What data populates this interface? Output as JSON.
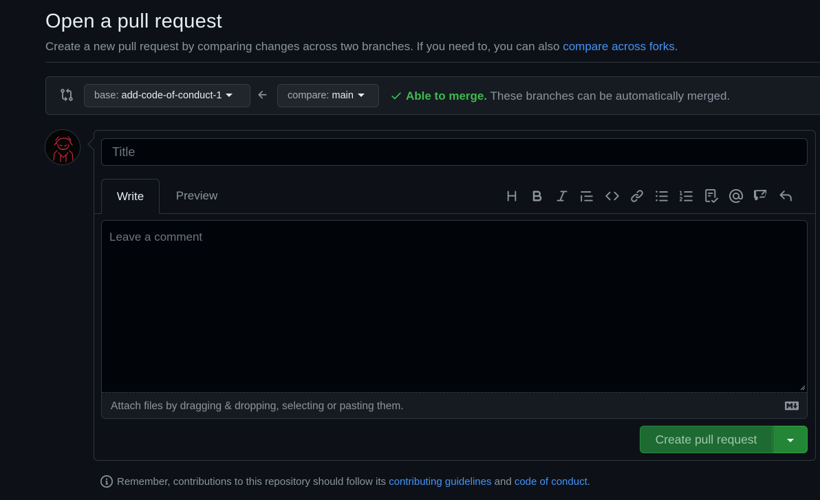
{
  "page": {
    "title": "Open a pull request",
    "subtitle_prefix": "Create a new pull request by comparing changes across two branches. If you need to, you can also ",
    "subtitle_link": "compare across forks",
    "subtitle_suffix": "."
  },
  "range": {
    "base_label": "base:",
    "base_branch": "add-code-of-conduct-1",
    "compare_label": "compare:",
    "compare_branch": "main",
    "merge_status_strong": "Able to merge.",
    "merge_status_text": "These branches can be automatically merged."
  },
  "form": {
    "title_placeholder": "Title",
    "tabs": [
      {
        "label": "Write",
        "active": true
      },
      {
        "label": "Preview",
        "active": false
      }
    ],
    "toolbar": [
      "heading-icon",
      "bold-icon",
      "italic-icon",
      "quote-icon",
      "code-icon",
      "link-icon",
      "unordered-list-icon",
      "ordered-list-icon",
      "task-list-icon",
      "mention-icon",
      "cross-reference-icon",
      "reply-icon"
    ],
    "comment_placeholder": "Leave a comment",
    "attach_text": "Attach files by dragging & dropping, selecting or pasting them.",
    "submit_label": "Create pull request"
  },
  "footnote": {
    "prefix": "Remember, contributions to this repository should follow its ",
    "link1": "contributing guidelines",
    "middle": " and ",
    "link2": "code of conduct",
    "suffix": "."
  },
  "colors": {
    "background": "#0d1117",
    "accent_link": "#4493f8",
    "success": "#3fb950",
    "primary_button": "#238636"
  }
}
